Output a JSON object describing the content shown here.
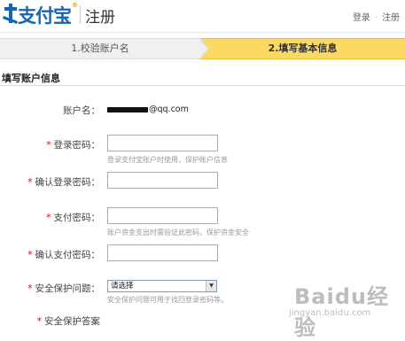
{
  "header": {
    "logo_text": "支付宝",
    "logo_tm": "®",
    "subtitle": "注册",
    "links": {
      "login": "登录",
      "separator": "·",
      "register": "注册"
    }
  },
  "steps": {
    "step1": "1.校验账户名",
    "step2": "2.填写基本信息"
  },
  "section": {
    "title": "填写账户信息"
  },
  "form": {
    "account": {
      "label": "账户名：",
      "value_suffix": "@qq.com"
    },
    "login_password": {
      "label": "登录密码：",
      "value": "",
      "hint": "登录支付宝账户时使用，保护账户信息"
    },
    "confirm_login_password": {
      "label": "确认登录密码：",
      "value": ""
    },
    "pay_password": {
      "label": "支付密码：",
      "value": "",
      "hint": "账户资金支出时需验证此密码，保护资金安全"
    },
    "confirm_pay_password": {
      "label": "确认支付密码：",
      "value": ""
    },
    "security_question": {
      "label": "安全保护问题：",
      "selected": "请选择",
      "hint": "安全保护问题可用于找回登录密码等。"
    },
    "partial_label": "安全保护答案"
  },
  "watermark": {
    "brand": "Baidu经验",
    "url": "jingyan.baidu.com"
  },
  "colors": {
    "brand_blue": "#1166b8",
    "active_step": "#fbd965",
    "required": "#e60012"
  }
}
